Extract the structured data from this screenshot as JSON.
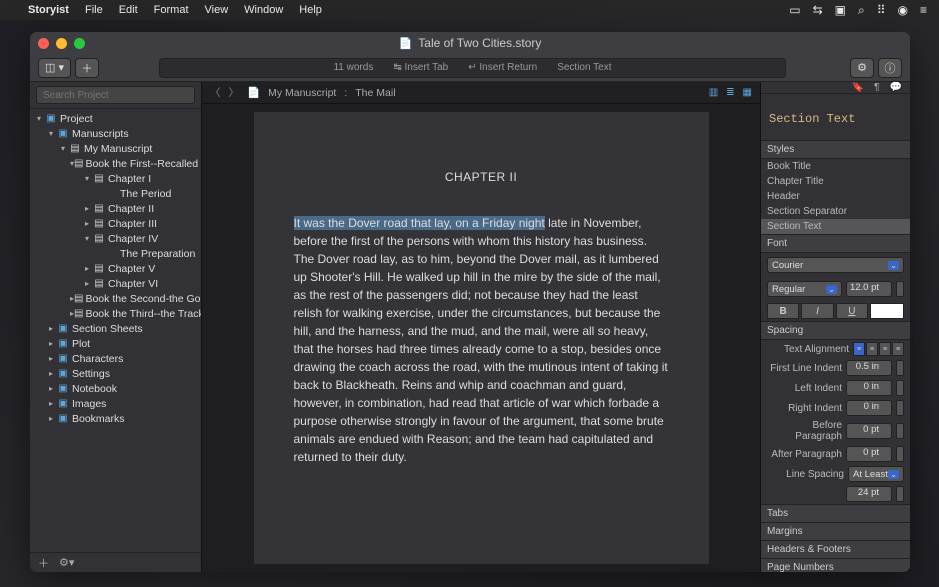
{
  "menubar": {
    "app": "Storyist",
    "items": [
      "File",
      "Edit",
      "Format",
      "View",
      "Window",
      "Help"
    ]
  },
  "window": {
    "title": "Tale of Two Cities.story"
  },
  "toolbar": {
    "words": "11 words",
    "insert_tab": "↹ Insert Tab",
    "insert_return": "↵ Insert Return",
    "section_text": "Section Text"
  },
  "sidebar": {
    "search_placeholder": "Search Project",
    "tree": [
      {
        "indent": 0,
        "disc": "▾",
        "icon": "folder",
        "label": "Project"
      },
      {
        "indent": 1,
        "disc": "▾",
        "icon": "folder",
        "label": "Manuscripts"
      },
      {
        "indent": 2,
        "disc": "▾",
        "icon": "page",
        "label": "My Manuscript"
      },
      {
        "indent": 3,
        "disc": "▾",
        "icon": "page",
        "label": "Book the First--Recalled to Life"
      },
      {
        "indent": 4,
        "disc": "▾",
        "icon": "page",
        "label": "Chapter I"
      },
      {
        "indent": 5,
        "disc": "",
        "icon": "",
        "label": "The Period"
      },
      {
        "indent": 4,
        "disc": "▸",
        "icon": "page",
        "label": "Chapter II"
      },
      {
        "indent": 4,
        "disc": "▸",
        "icon": "page",
        "label": "Chapter III"
      },
      {
        "indent": 4,
        "disc": "▾",
        "icon": "page",
        "label": "Chapter IV"
      },
      {
        "indent": 5,
        "disc": "",
        "icon": "",
        "label": "The Preparation"
      },
      {
        "indent": 4,
        "disc": "▸",
        "icon": "page",
        "label": "Chapter V"
      },
      {
        "indent": 4,
        "disc": "▸",
        "icon": "page",
        "label": "Chapter VI"
      },
      {
        "indent": 3,
        "disc": "▸",
        "icon": "page",
        "label": "Book the Second-the Golden Thread"
      },
      {
        "indent": 3,
        "disc": "▸",
        "icon": "page",
        "label": "Book the Third--the Track of a Storm"
      },
      {
        "indent": 1,
        "disc": "▸",
        "icon": "folder",
        "label": "Section Sheets"
      },
      {
        "indent": 1,
        "disc": "▸",
        "icon": "folder",
        "label": "Plot"
      },
      {
        "indent": 1,
        "disc": "▸",
        "icon": "folder",
        "label": "Characters"
      },
      {
        "indent": 1,
        "disc": "▸",
        "icon": "folder",
        "label": "Settings"
      },
      {
        "indent": 1,
        "disc": "▸",
        "icon": "folder",
        "label": "Notebook"
      },
      {
        "indent": 1,
        "disc": "▸",
        "icon": "folder",
        "label": "Images"
      },
      {
        "indent": 1,
        "disc": "▸",
        "icon": "folder",
        "label": "Bookmarks"
      }
    ]
  },
  "pathbar": {
    "crumb1": "My Manuscript",
    "sep": ":",
    "crumb2": "The Mail"
  },
  "editor": {
    "chapter_heading": "CHAPTER II",
    "selected_text": "It was the Dover road that lay, on a Friday night",
    "body_text": " late in November, before the first of the persons with whom this history has business. The Dover road lay, as to him, beyond the Dover mail, as it lumbered up Shooter's Hill. He walked up hill in the mire by the side of the mail, as the rest of the passengers did; not because they had the least relish for walking exercise, under the circumstances, but because the hill, and the harness, and the mud, and the mail, were all so heavy, that the horses had three times already come to a stop, besides once drawing the coach across the road, with the mutinous intent of taking it back to Blackheath. Reins and whip and coachman and guard, however, in combination, had read that article of war which forbade a purpose otherwise strongly in favour of the argument, that some brute animals are endued with Reason; and the team had capitulated and returned to their duty."
  },
  "inspector": {
    "title": "Section Text",
    "styles_header": "Styles",
    "styles": [
      "Book Title",
      "Chapter Title",
      "Header",
      "Section Separator",
      "Section Text"
    ],
    "font_header": "Font",
    "font_name": "Courier",
    "font_weight": "Regular",
    "font_size": "12.0 pt",
    "spacing_header": "Spacing",
    "text_alignment_label": "Text Alignment",
    "first_line_indent_label": "First Line Indent",
    "first_line_indent": "0.5 in",
    "left_indent_label": "Left Indent",
    "left_indent": "0 in",
    "right_indent_label": "Right Indent",
    "right_indent": "0 in",
    "before_para_label": "Before Paragraph",
    "before_para": "0 pt",
    "after_para_label": "After Paragraph",
    "after_para": "0 pt",
    "line_spacing_label": "Line Spacing",
    "line_spacing_mode": "At Least",
    "line_spacing_value": "24 pt",
    "tabs_header": "Tabs",
    "margins_header": "Margins",
    "headers_footers_header": "Headers & Footers",
    "page_numbers_header": "Page Numbers"
  }
}
